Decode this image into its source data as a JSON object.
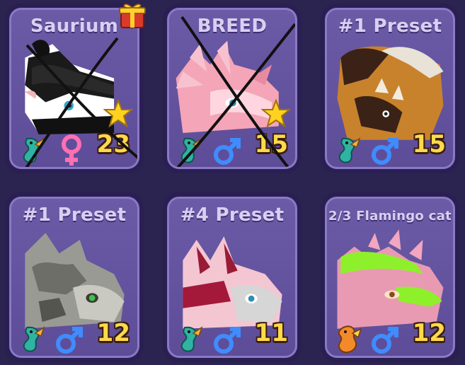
{
  "cards": [
    {
      "name": "Saurium",
      "level": "23",
      "gender": "female",
      "starred": true,
      "crossed_out": true,
      "has_gift_icon": true,
      "element_icon": "sea-dragon-icon"
    },
    {
      "name": "BREED",
      "level": "15",
      "gender": "male",
      "starred": true,
      "crossed_out": true,
      "has_gift_icon": false,
      "element_icon": "sea-dragon-icon"
    },
    {
      "name": "#1 Preset",
      "level": "15",
      "gender": "male",
      "starred": false,
      "crossed_out": false,
      "has_gift_icon": false,
      "element_icon": "sea-dragon-icon"
    },
    {
      "name": "#1 Preset",
      "level": "12",
      "gender": "male",
      "starred": false,
      "crossed_out": false,
      "has_gift_icon": false,
      "element_icon": "sea-dragon-icon"
    },
    {
      "name": "#4 Preset",
      "level": "11",
      "gender": "male",
      "starred": false,
      "crossed_out": false,
      "has_gift_icon": false,
      "element_icon": "sea-dragon-icon"
    },
    {
      "name": "2/3 Flamingo cat",
      "level": "12",
      "gender": "male",
      "starred": false,
      "crossed_out": false,
      "has_gift_icon": false,
      "element_icon": "fire-dragon-icon"
    }
  ],
  "colors": {
    "card_bg": "#5d4d98",
    "level_text": "#ffd94a",
    "female_symbol": "#ff6fb4",
    "male_symbol": "#3f8cff",
    "star": "#ffd21f"
  }
}
